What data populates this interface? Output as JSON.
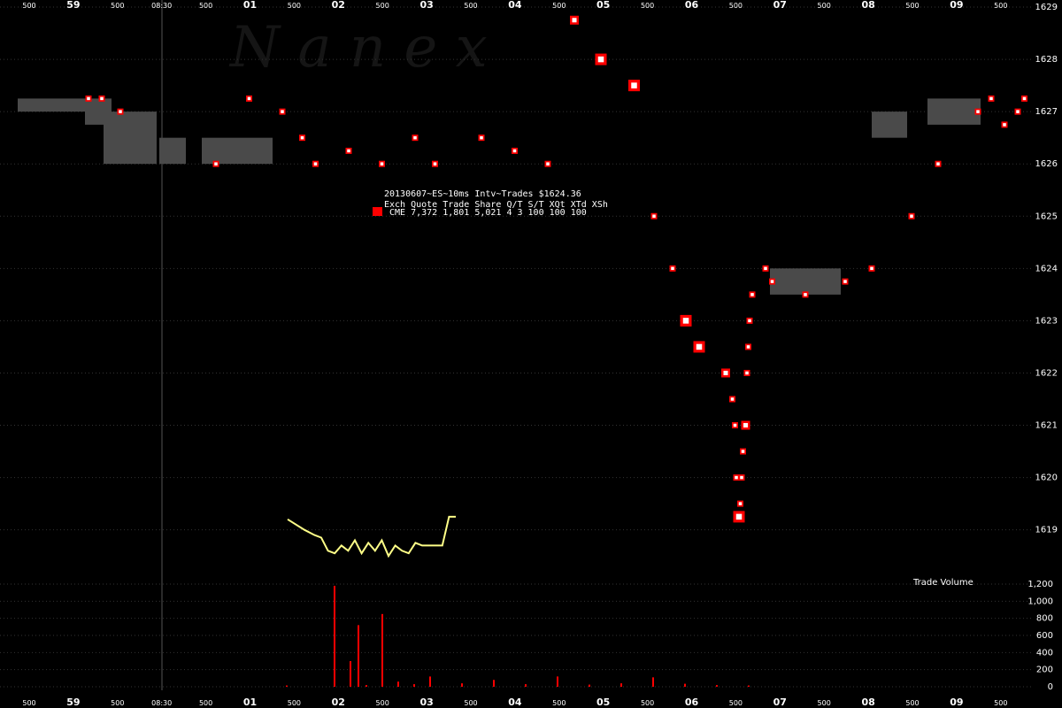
{
  "watermark": "N a n e x",
  "info": {
    "title": "20130607~ES~10ms Intv~Trades $1624.36",
    "header": "Exch Quote Trade Share  Q/T   S/T  XQt XTd XSh",
    "row": "CME 7,372 1,801 5,021     4     3 100 100 100",
    "swatch_color": "#ff0000"
  },
  "colors": {
    "background": "#000000",
    "trade_fill": "#ff0000",
    "range_band": "#4a4a4a",
    "quote": "#ffff88",
    "volume": "#ff0000",
    "grid": "#333333"
  },
  "chart_data": [
    {
      "type": "scatter",
      "title": "",
      "x_ticks": [
        "500",
        "59",
        "500",
        "08:30",
        "500",
        "01",
        "500",
        "02",
        "500",
        "03",
        "500",
        "04",
        "500",
        "05",
        "500",
        "06",
        "500",
        "07",
        "500",
        "08",
        "500",
        "09",
        "500"
      ],
      "x_ticks_bold": [
        "59",
        "01",
        "02",
        "03",
        "04",
        "05",
        "06",
        "07",
        "08",
        "09"
      ],
      "ylim": [
        1618.3,
        1629
      ],
      "y_ticks": [
        "1619",
        "1620",
        "1621",
        "1622",
        "1623",
        "1624",
        "1625",
        "1626",
        "1627",
        "1628",
        "1629"
      ],
      "series": [
        {
          "kind": "trades",
          "x": [
            0.0,
            0.1,
            0.24,
            0.96,
            1.21,
            1.46,
            1.61,
            1.71,
            1.96,
            2.21,
            2.46,
            2.61,
            2.96,
            3.21,
            3.46,
            3.66,
            3.86,
            4.11,
            4.26,
            4.4,
            4.5,
            4.6,
            4.8,
            4.85,
            4.87,
            4.88,
            4.9,
            4.91,
            4.92,
            4.93,
            4.95,
            4.96,
            4.97,
            4.98,
            5.0,
            5.1,
            5.15,
            5.4,
            5.7,
            5.9,
            6.2,
            6.4,
            6.7,
            6.8,
            6.9,
            7.0,
            7.05
          ],
          "y": [
            1627.25,
            1627.25,
            1627.0,
            1626.0,
            1627.25,
            1627.0,
            1626.5,
            1626.0,
            1626.25,
            1626.0,
            1626.5,
            1626.0,
            1626.5,
            1626.25,
            1626.0,
            1628.75,
            1628.0,
            1627.5,
            1625.0,
            1624.0,
            1623.0,
            1622.5,
            1622.0,
            1621.5,
            1621.0,
            1620.0,
            1619.25,
            1619.5,
            1620.0,
            1620.5,
            1621.0,
            1622.0,
            1622.5,
            1623.0,
            1623.5,
            1624.0,
            1623.75,
            1623.5,
            1623.75,
            1624.0,
            1625.0,
            1626.0,
            1627.0,
            1627.25,
            1626.75,
            1627.0,
            1627.25
          ],
          "size": [
            1,
            1,
            1,
            1,
            1,
            1,
            1,
            1,
            1,
            1,
            1,
            1,
            1,
            1,
            1,
            2,
            3,
            3,
            1,
            1,
            3,
            3,
            2,
            1,
            1,
            1,
            3,
            1,
            1,
            1,
            2,
            1,
            1,
            1,
            1,
            1,
            1,
            1,
            1,
            1,
            1,
            1,
            1,
            1,
            1,
            1,
            1
          ]
        },
        {
          "kind": "quote",
          "x": [
            0.0,
            0.05,
            0.08,
            0.1,
            0.12,
            0.14,
            0.16,
            0.18,
            0.2,
            0.22,
            0.24,
            0.26,
            0.28,
            0.3,
            0.32,
            0.34,
            0.36,
            0.38,
            0.4,
            0.42,
            0.44,
            0.46,
            0.48,
            0.5
          ],
          "y": [
            1619.2,
            1619.0,
            1618.9,
            1618.85,
            1618.6,
            1618.55,
            1618.7,
            1618.6,
            1618.8,
            1618.55,
            1618.75,
            1618.6,
            1618.8,
            1618.5,
            1618.7,
            1618.6,
            1618.55,
            1618.75,
            1618.7,
            1618.7,
            1618.7,
            1618.7,
            1619.25,
            1619.25
          ]
        }
      ]
    },
    {
      "type": "bar",
      "title": "Trade Volume",
      "ylim": [
        0,
        1200
      ],
      "y_ticks": [
        "0",
        "200",
        "400",
        "600",
        "800",
        "1,000",
        "1,200"
      ],
      "x": [
        0.1,
        0.4,
        0.5,
        0.55,
        0.6,
        0.7,
        0.8,
        0.9,
        1.0,
        1.2,
        1.4,
        1.6,
        1.8,
        2.0,
        2.2,
        2.4,
        2.6,
        2.8,
        3.0
      ],
      "values": [
        15,
        1180,
        300,
        720,
        20,
        850,
        60,
        30,
        120,
        40,
        80,
        30,
        120,
        25,
        40,
        110,
        35,
        20,
        15
      ]
    }
  ]
}
